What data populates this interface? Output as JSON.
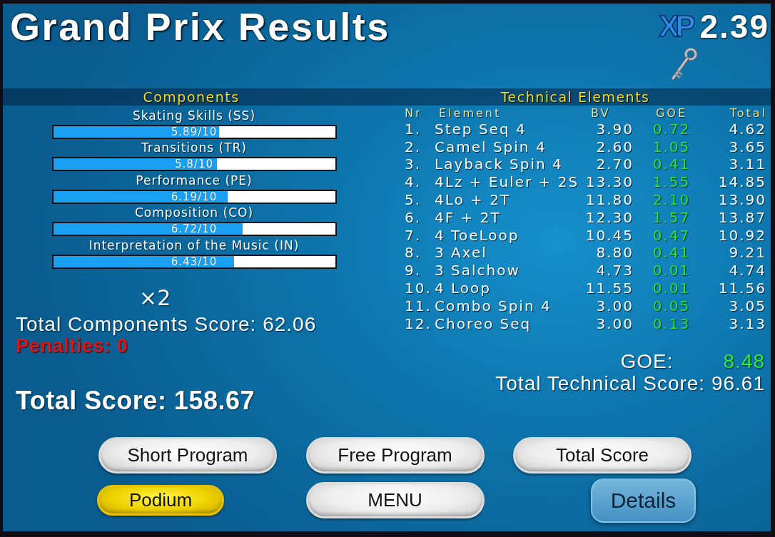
{
  "title": "Grand Prix Results",
  "xp": {
    "logo": "XP",
    "value": "2.39"
  },
  "components": {
    "heading": "Components",
    "items": [
      {
        "name": "Skating Skills (SS)",
        "reading": "5.89/10",
        "level": 0.589
      },
      {
        "name": "Transitions (TR)",
        "reading": "5.8/10",
        "level": 0.58
      },
      {
        "name": "Performance (PE)",
        "reading": "6.19/10",
        "level": 0.619
      },
      {
        "name": "Composition (CO)",
        "reading": "6.72/10",
        "level": 0.672
      },
      {
        "name": "Interpretation of the Music (IN)",
        "reading": "6.43/10",
        "level": 0.643
      }
    ],
    "factor": "×2",
    "total": "Total Components Score: 62.06",
    "penalties": "Penalties: 0",
    "total_score": "Total Score: 158.67"
  },
  "technical": {
    "heading": "Technical Elements",
    "columns": [
      "Nr",
      "Element",
      "BV",
      "GOE",
      "Total"
    ],
    "rows": [
      {
        "nr": "1.",
        "element": "Step Seq 4",
        "bv": "3.90",
        "goe": "0.72",
        "total": "4.62"
      },
      {
        "nr": "2.",
        "element": "Camel Spin 4",
        "bv": "2.60",
        "goe": "1.05",
        "total": "3.65"
      },
      {
        "nr": "3.",
        "element": "Layback Spin 4",
        "bv": "2.70",
        "goe": "0.41",
        "total": "3.11"
      },
      {
        "nr": "4.",
        "element": "4Lz + Euler + 2S",
        "bv": "13.30",
        "goe": "1.55",
        "total": "14.85"
      },
      {
        "nr": "5.",
        "element": "4Lo + 2T",
        "bv": "11.80",
        "goe": "2.10",
        "total": "13.90"
      },
      {
        "nr": "6.",
        "element": "4F + 2T",
        "bv": "12.30",
        "goe": "1.57",
        "total": "13.87"
      },
      {
        "nr": "7.",
        "element": "4 ToeLoop",
        "bv": "10.45",
        "goe": "0.47",
        "total": "10.92"
      },
      {
        "nr": "8.",
        "element": "3 Axel",
        "bv": "8.80",
        "goe": "0.41",
        "total": "9.21"
      },
      {
        "nr": "9.",
        "element": "3 Salchow",
        "bv": "4.73",
        "goe": "0.01",
        "total": "4.74"
      },
      {
        "nr": "10.",
        "element": "4 Loop",
        "bv": "11.55",
        "goe": "0.01",
        "total": "11.56"
      },
      {
        "nr": "11.",
        "element": "Combo Spin 4",
        "bv": "3.00",
        "goe": "0.05",
        "total": "3.05"
      },
      {
        "nr": "12.",
        "element": "Choreo Seq",
        "bv": "3.00",
        "goe": "0.13",
        "total": "3.13"
      }
    ],
    "goe_label": "GOE:",
    "goe_value": "8.48",
    "total": "Total Technical Score: 96.61"
  },
  "buttons": [
    {
      "label": "Short Program",
      "kind": "silver"
    },
    {
      "label": "Free Program",
      "kind": "silver"
    },
    {
      "label": "Total Score",
      "kind": "silver"
    },
    {
      "label": "Podium",
      "kind": "gold"
    },
    {
      "label": "MENU",
      "kind": "silver"
    },
    {
      "label": "Details",
      "kind": "glass"
    }
  ]
}
